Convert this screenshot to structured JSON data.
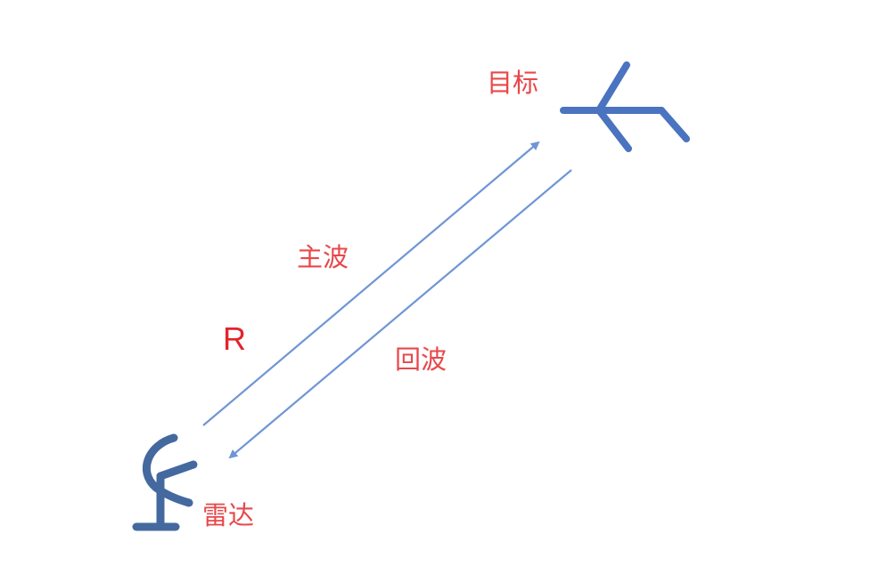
{
  "diagram": {
    "labels": {
      "target": "目标",
      "main_wave": "主波",
      "range": "R",
      "echo_wave": "回波",
      "radar": "雷达"
    },
    "colors": {
      "label": "#e8484a",
      "range_label": "#e3242b",
      "arrow": "#6f95d6",
      "radar_icon": "#44699f",
      "target_icon": "#4a73c0"
    },
    "icons": {
      "target": "aircraft-icon",
      "radar": "radar-antenna-icon"
    }
  }
}
